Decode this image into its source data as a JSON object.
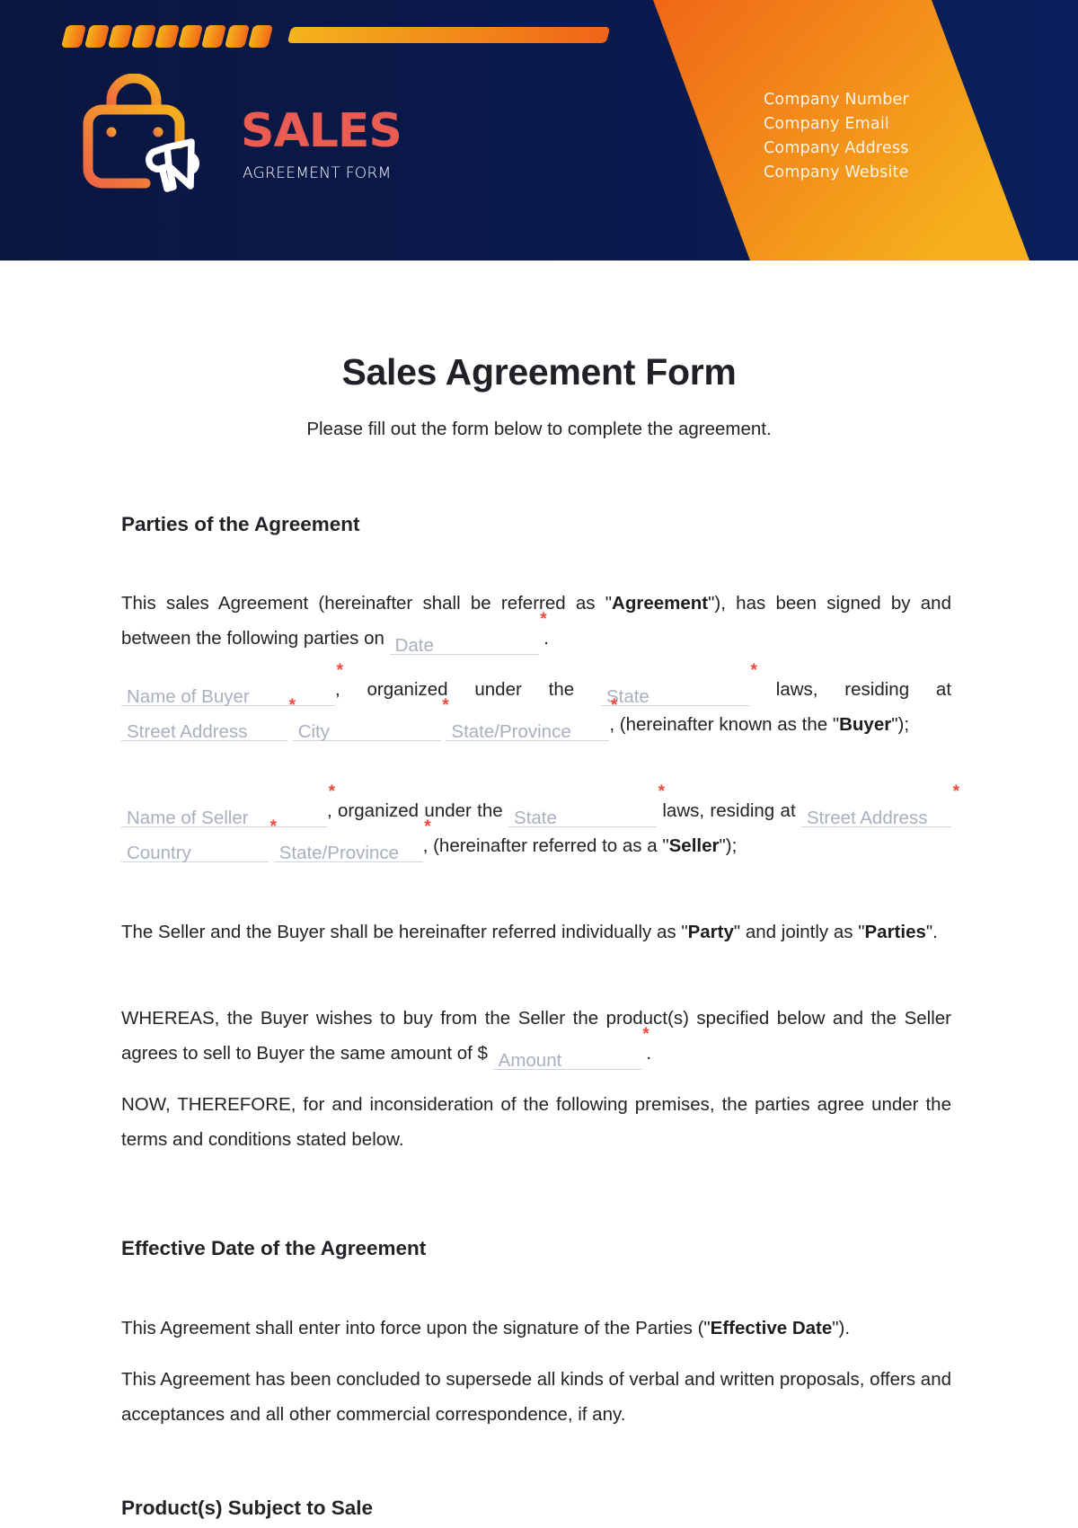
{
  "header": {
    "brand_title": "SALES",
    "brand_subtitle": "AGREEMENT FORM",
    "company_lines": [
      "Company Number",
      "Company Email",
      "Company Address",
      "Company Website"
    ],
    "colors": {
      "navy": "#0a1a4e",
      "orange": "#f07818",
      "yellow": "#f4b31d",
      "brand_red": "#ea5b52"
    }
  },
  "document": {
    "title": "Sales Agreement Form",
    "subtitle": "Please fill out the form below to complete the agreement.",
    "required_mark": "*",
    "sections": {
      "parties": {
        "heading": "Parties of the Agreement",
        "intro": {
          "t1": "This sales Agreement (hereinafter shall be referred as \"",
          "b1": "Agreement",
          "t2": "\"), has been signed by and between the following parties on",
          "date_placeholder": "Date",
          "t3": "."
        },
        "buyer": {
          "name_placeholder": "Name of Buyer",
          "t1": ", organized under the",
          "state_placeholder": "State",
          "t2": "laws, residing at",
          "street_placeholder": "Street Address",
          "city_placeholder": "City",
          "province_placeholder": "State/Province",
          "t3": ", (hereinafter known as the \"",
          "b1": "Buyer",
          "t4": "\");"
        },
        "seller": {
          "name_placeholder": "Name of Seller",
          "t1": ", organized under the",
          "state_placeholder": "State",
          "t2": "laws, residing at",
          "street_placeholder": "Street Address",
          "country_placeholder": "Country",
          "province_placeholder": "State/Province",
          "t3": ", (hereinafter referred to as a \"",
          "b1": "Seller",
          "t4": "\");"
        },
        "party": {
          "t1": "The Seller and the Buyer shall be hereinafter referred individually as \"",
          "b1": "Party",
          "t2": "\" and jointly as \"",
          "b2": "Parties",
          "t3": "\"."
        },
        "whereas": {
          "t1": "WHEREAS, the Buyer wishes to buy from the Seller the product(s) specified below and the Seller agrees to sell to Buyer the same amount of $",
          "amount_placeholder": "Amount",
          "t2": "."
        },
        "now": "NOW, THEREFORE, for and inconsideration of the following premises, the parties agree under the terms and conditions stated below."
      },
      "effective": {
        "heading": "Effective Date of the Agreement",
        "p1_t1": "This Agreement shall enter into force upon the signature of the Parties (\"",
        "p1_b1": "Effective Date",
        "p1_t2": "\").",
        "p2": "This Agreement has been concluded to supersede all kinds of verbal and written proposals, offers and acceptances and all other commercial correspondence, if any."
      },
      "products": {
        "heading": "Product(s) Subject to Sale"
      }
    }
  }
}
